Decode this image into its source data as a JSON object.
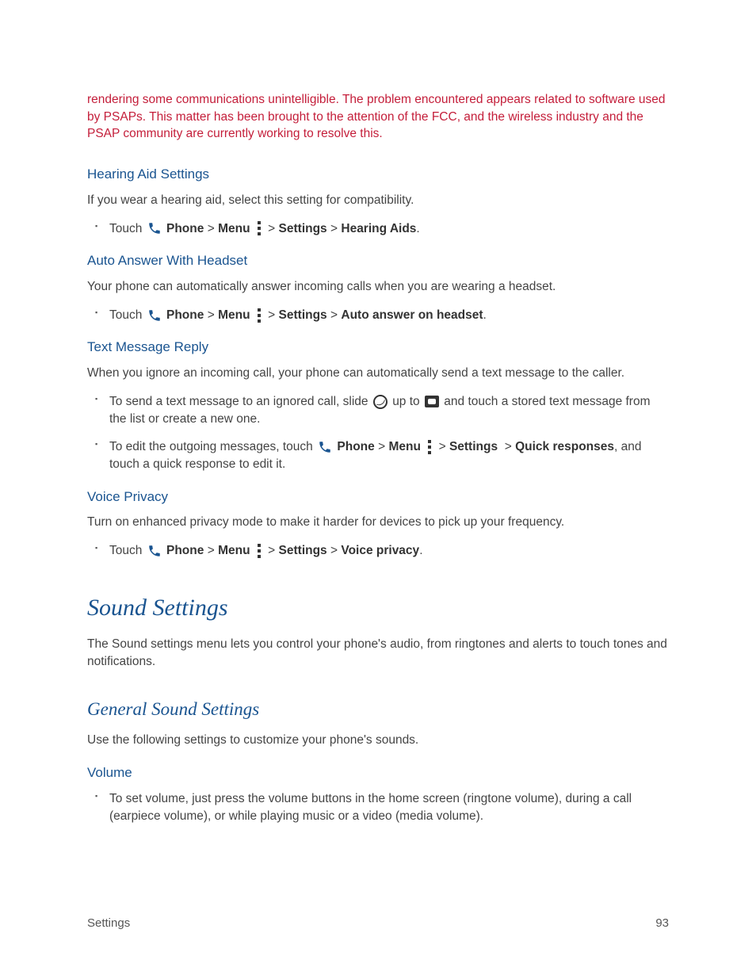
{
  "warning": "rendering some communications unintelligible. The problem encountered appears related to software used by PSAPs. This matter has been brought to the attention of the FCC, and the wireless industry and the PSAP community are currently working to resolve this.",
  "sections": {
    "hearing_aid": {
      "title": "Hearing Aid Settings",
      "intro": "If you wear a hearing aid, select this setting for compatibility.",
      "touch": "Touch",
      "phone": "Phone",
      "menu": "Menu",
      "settings": "Settings",
      "target": "Hearing Aids"
    },
    "auto_answer": {
      "title": "Auto Answer With Headset",
      "intro": "Your phone can automatically answer incoming calls when you are wearing a headset.",
      "touch": "Touch",
      "phone": "Phone",
      "menu": "Menu",
      "settings": "Settings",
      "target": "Auto answer on headset"
    },
    "text_reply": {
      "title": "Text Message Reply",
      "intro": "When you ignore an incoming call, your phone can automatically send a text message to the caller.",
      "item1_pre": "To send a text message to an ignored call, slide",
      "item1_mid": "up to",
      "item1_post": "and touch a stored text message from the list or create a new one.",
      "item2_pre": "To edit the outgoing messages, touch",
      "phone": "Phone",
      "menu": "Menu",
      "settings": "Settings",
      "quick": "Quick responses",
      "item2_post": ", and touch a quick response to edit it."
    },
    "voice_privacy": {
      "title": "Voice Privacy",
      "intro": "Turn on enhanced privacy mode to make it harder for devices to pick up your frequency.",
      "touch": "Touch",
      "phone": "Phone",
      "menu": "Menu",
      "settings": "Settings",
      "target": "Voice privacy"
    }
  },
  "sound": {
    "title": "Sound Settings",
    "intro": "The Sound settings menu lets you control your phone's audio, from ringtones and alerts to touch tones and notifications."
  },
  "general_sound": {
    "title": "General Sound Settings",
    "intro": "Use the following settings to customize your phone's sounds."
  },
  "volume": {
    "title": "Volume",
    "item1": "To set volume, just press the volume buttons in the home screen (ringtone volume), during a call (earpiece volume), or while playing music or a video (media volume)."
  },
  "footer": {
    "label": "Settings",
    "page": "93"
  },
  "sep": ">"
}
